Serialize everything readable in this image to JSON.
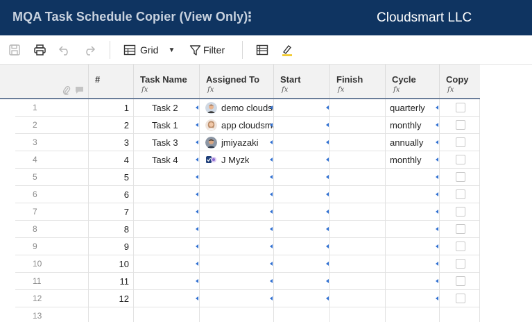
{
  "header": {
    "title": "MQA Task Schedule Copier (View Only)",
    "kebab": "⋮",
    "company": "Cloudsmart LLC"
  },
  "toolbar": {
    "icons": [
      "save-icon",
      "print-icon",
      "undo-icon",
      "redo-icon",
      "grid-icon",
      "filter-icon",
      "card-view-icon",
      "highlight-icon"
    ],
    "grid_label": "Grid",
    "filter_label": "Filter"
  },
  "columns": {
    "hash": "#",
    "task_name": "Task Name",
    "assigned_to": "Assigned To",
    "start": "Start",
    "finish": "Finish",
    "cycle": "Cycle",
    "copy": "Copy",
    "formula_glyph": "fx"
  },
  "rows": [
    {
      "num": "1",
      "idx": "1",
      "task": "Task 2",
      "assigned": "demo cloudsmart",
      "start": "",
      "finish": "",
      "cycle": "quarterly",
      "avatar": "man-photo"
    },
    {
      "num": "2",
      "idx": "2",
      "task": "Task 1",
      "assigned": "app cloudsmart",
      "start": "",
      "finish": "",
      "cycle": "monthly",
      "avatar": "woman-photo"
    },
    {
      "num": "3",
      "idx": "3",
      "task": "Task 3",
      "assigned": "jmiyazaki",
      "start": "",
      "finish": "",
      "cycle": "annually",
      "avatar": "man2-photo"
    },
    {
      "num": "4",
      "idx": "4",
      "task": "Task 4",
      "assigned": "J Myzk",
      "start": "",
      "finish": "",
      "cycle": "monthly",
      "avatar": "app-badge"
    },
    {
      "num": "5",
      "idx": "5"
    },
    {
      "num": "6",
      "idx": "6"
    },
    {
      "num": "7",
      "idx": "7"
    },
    {
      "num": "8",
      "idx": "8"
    },
    {
      "num": "9",
      "idx": "9"
    },
    {
      "num": "10",
      "idx": "10"
    },
    {
      "num": "11",
      "idx": "11"
    },
    {
      "num": "12",
      "idx": "12"
    },
    {
      "num": "13",
      "idx": ""
    }
  ],
  "colors": {
    "header_bg": "#0f3461",
    "marker": "#2f6fd1"
  }
}
